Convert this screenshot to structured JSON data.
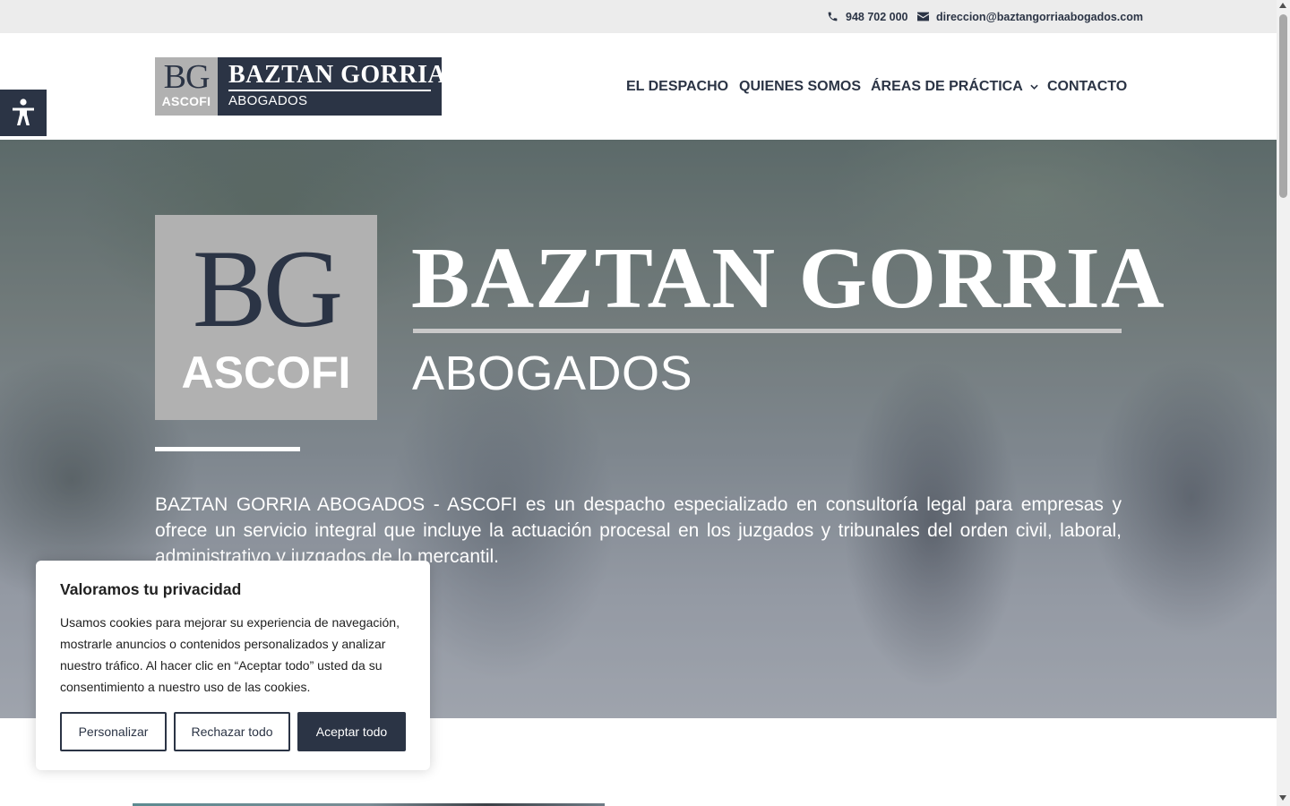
{
  "topbar": {
    "phone": "948 702 000",
    "email": "direccion@baztangorriaabogados.com"
  },
  "header": {
    "logo": {
      "monogram": "BG",
      "monogram_sub": "ASCOFI",
      "name": "BAZTAN GORRIA",
      "subtitle": "ABOGADOS"
    },
    "nav": [
      {
        "label": "EL DESPACHO"
      },
      {
        "label": "QUIENES SOMOS"
      },
      {
        "label": "ÁREAS DE PRÁCTICA"
      },
      {
        "label": "CONTACTO"
      }
    ]
  },
  "hero": {
    "monogram": "BG",
    "monogram_sub": "ASCOFI",
    "title": "BAZTAN GORRIA",
    "subtitle": "ABOGADOS",
    "description": "BAZTAN GORRIA ABOGADOS - ASCOFI es un despacho especializado en consultoría legal para empresas y ofrece un servicio integral que incluye la actuación procesal en los juzgados y tribunales del orden civil, laboral, administrativo y juzgados de lo mercantil."
  },
  "cookie": {
    "title": "Valoramos tu privacidad",
    "text": "Usamos cookies para mejorar su experiencia de navegación, mostrarle anuncios o contenidos personalizados y analizar nuestro tráfico. Al hacer clic en “Aceptar todo” usted da su consentimiento a nuestro uso de las cookies.",
    "customize_label": "Personalizar",
    "reject_label": "Rechazar todo",
    "accept_label": "Aceptar todo"
  },
  "colors": {
    "brand_navy": "#2b3445",
    "monogram_gray": "#b1b1b1",
    "topbar_bg": "#ececec"
  },
  "icons": {
    "phone": "phone-icon",
    "email": "envelope-icon",
    "accessibility": "accessibility-icon",
    "dropdown": "chevron-down-icon"
  }
}
